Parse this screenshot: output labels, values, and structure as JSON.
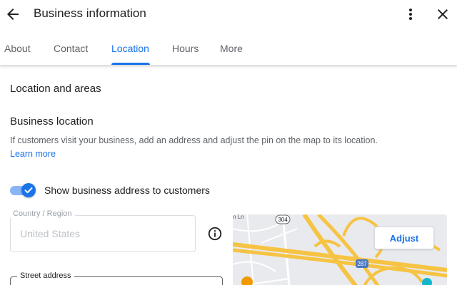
{
  "header": {
    "title": "Business information"
  },
  "tabs": [
    {
      "label": "About"
    },
    {
      "label": "Contact"
    },
    {
      "label": "Location"
    },
    {
      "label": "Hours"
    },
    {
      "label": "More"
    }
  ],
  "active_tab": "Location",
  "accent_color": "#1a73e8",
  "content": {
    "section_title": "Location and areas",
    "business_location": {
      "title": "Business location",
      "description": "If customers visit your business, add an address and adjust the pin on the map to its location.",
      "learn_more": "Learn more"
    },
    "toggle": {
      "label": "Show business address to customers",
      "checked": true
    },
    "country_field": {
      "label": "Country / Region",
      "value": "United States"
    },
    "street_field": {
      "label": "Street address"
    },
    "map": {
      "adjust_label": "Adjust",
      "route_labels": [
        "304",
        "287"
      ],
      "street_fragment": "n Ln"
    }
  }
}
